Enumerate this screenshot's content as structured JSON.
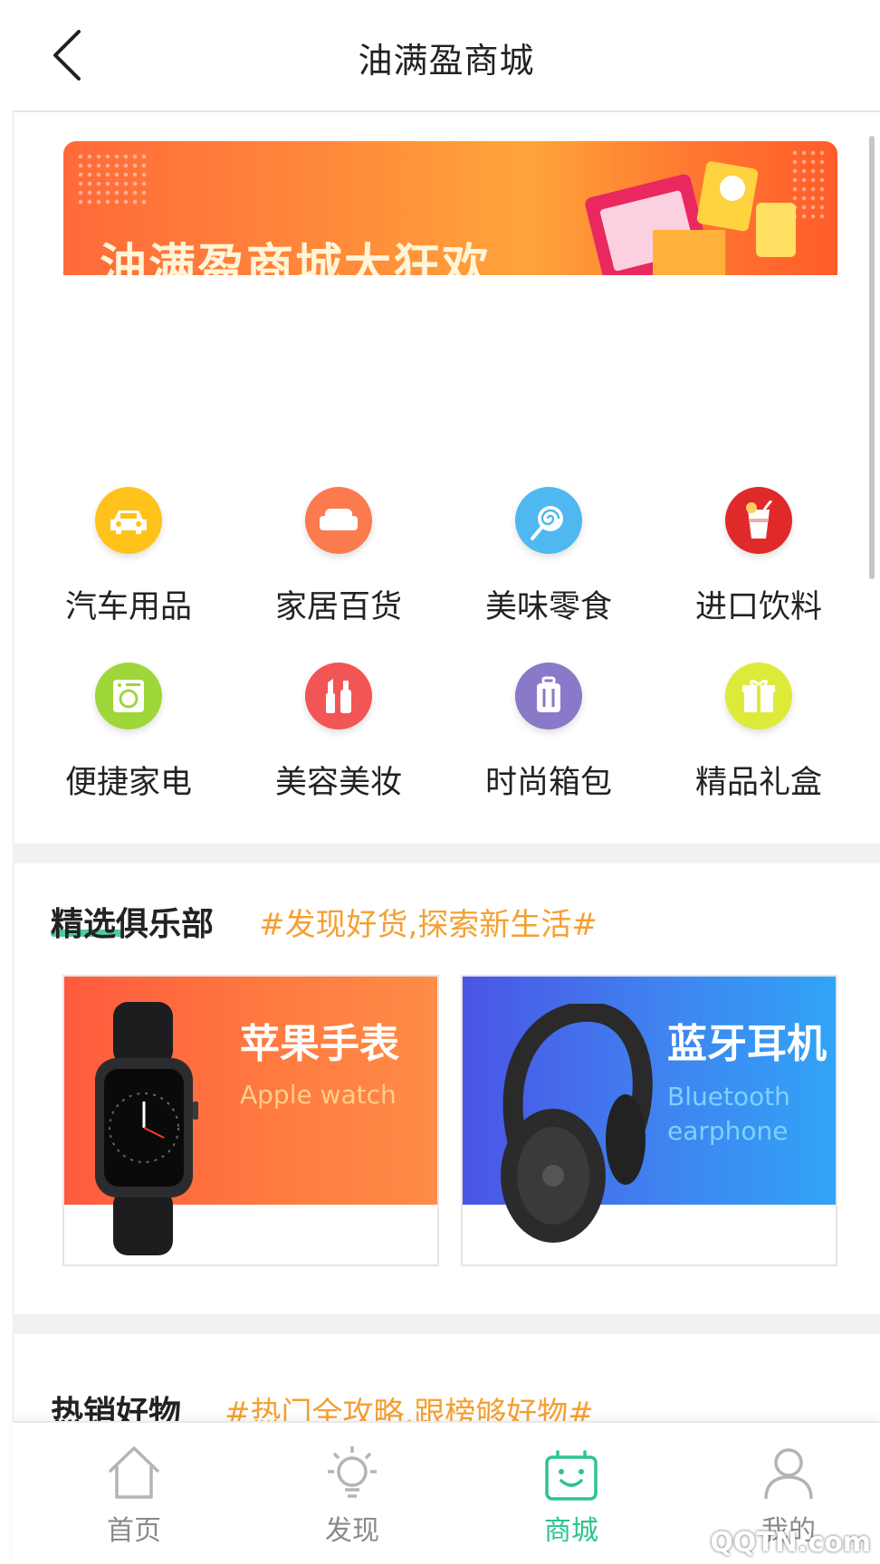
{
  "header": {
    "title": "油满盈商城"
  },
  "banner": {
    "title": "油满盈商城大狂欢"
  },
  "categories": [
    {
      "label": "汽车用品",
      "icon": "car-icon",
      "color": "#ffc21a"
    },
    {
      "label": "家居百货",
      "icon": "sofa-icon",
      "color": "#fb7a4e"
    },
    {
      "label": "美味零食",
      "icon": "lollipop-icon",
      "color": "#4fb8f0"
    },
    {
      "label": "进口饮料",
      "icon": "drink-icon",
      "color": "#e02a2a"
    },
    {
      "label": "便捷家电",
      "icon": "washing-machine-icon",
      "color": "#9fd639"
    },
    {
      "label": "美容美妆",
      "icon": "cosmetics-icon",
      "color": "#f25555"
    },
    {
      "label": "时尚箱包",
      "icon": "luggage-icon",
      "color": "#8a78c8"
    },
    {
      "label": "精品礼盒",
      "icon": "gift-icon",
      "color": "#ddea3a"
    }
  ],
  "club": {
    "title": "精选俱乐部",
    "tag": "#发现好货,探索新生活#",
    "cards": [
      {
        "title": "苹果手表",
        "subtitle_line1": "Apple watch",
        "subtitle_line2": ""
      },
      {
        "title": "蓝牙耳机",
        "subtitle_line1": "Bluetooth",
        "subtitle_line2": "earphone"
      }
    ]
  },
  "hot": {
    "title": "热销好物",
    "tag": "#热门全攻略,跟榜够好物#"
  },
  "tabbar": {
    "items": [
      {
        "label": "首页",
        "icon": "home-icon",
        "active": false
      },
      {
        "label": "发现",
        "icon": "bulb-icon",
        "active": false
      },
      {
        "label": "商城",
        "icon": "shopping-bag-icon",
        "active": true
      },
      {
        "label": "我的",
        "icon": "user-icon",
        "active": false
      }
    ]
  },
  "watermark": "QQTN.com",
  "colors": {
    "accent": "#2bc58c",
    "tag": "#f5a032"
  }
}
